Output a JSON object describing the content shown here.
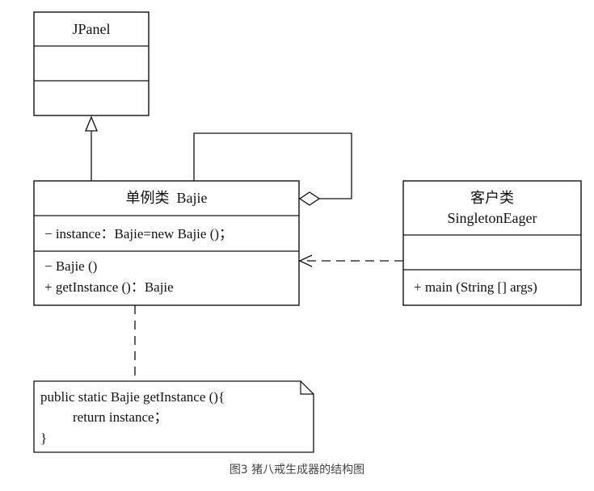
{
  "jpanel": {
    "name": "JPanel"
  },
  "bajie": {
    "name": "单例类  Bajie",
    "attribute": "− instance：Bajie=new Bajie ()；",
    "ops": [
      "− Bajie ()",
      "+ getInstance ()：Bajie"
    ]
  },
  "client": {
    "stereotype": "客户类",
    "name": "SingletonEager",
    "op": "+ main (String [] args)"
  },
  "note": {
    "lines": [
      "public static Bajie getInstance (){",
      "return instance；",
      "}"
    ]
  },
  "caption": "图3 猪八戒生成器的结构图"
}
